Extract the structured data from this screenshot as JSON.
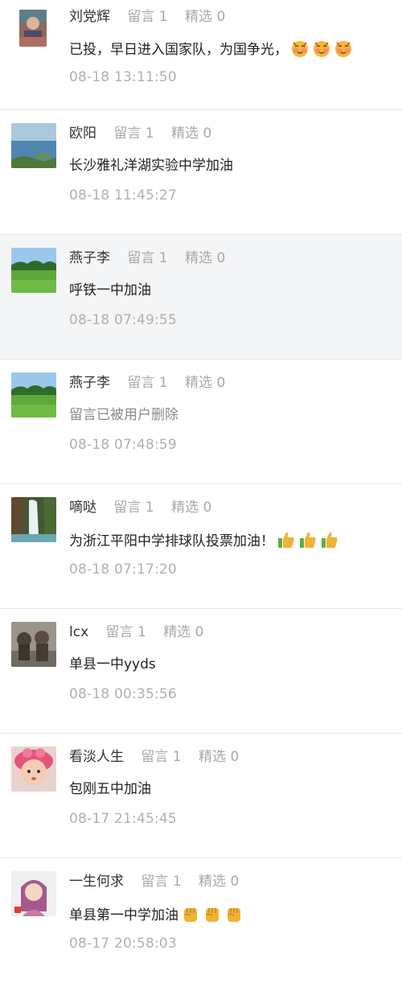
{
  "comments": [
    {
      "name": "刘党辉",
      "replies": "留言 1",
      "featured": "精选 0",
      "text": "已投，早日进入国家队，为国争光，",
      "time": "08-18 13:11:50",
      "emoji": "blush-face-icon",
      "avatar": "portrait-avatar"
    },
    {
      "name": "欧阳",
      "replies": "留言 1",
      "featured": "精选 0",
      "text": "长沙雅礼洋湖实验中学加油",
      "time": "08-18 11:45:27",
      "avatar": "lake-avatar"
    },
    {
      "name": "燕子李",
      "replies": "留言 1",
      "featured": "精选 0",
      "text": "呼铁一中加油",
      "time": "08-18 07:49:55",
      "avatar": "meadow-avatar"
    },
    {
      "name": "燕子李",
      "replies": "留言 1",
      "featured": "精选 0",
      "text": "留言已被用户删除",
      "time": "08-18 07:48:59",
      "avatar": "meadow-avatar"
    },
    {
      "name": "嘀哒",
      "replies": "留言 1",
      "featured": "精选 0",
      "text": "为浙江平阳中学排球队投票加油！",
      "time": "08-18 07:17:20",
      "emoji": "thumbs-up-icon",
      "avatar": "waterfall-avatar"
    },
    {
      "name": "lcx",
      "replies": "留言 1",
      "featured": "精选 0",
      "text": "单县一中yyds",
      "time": "08-18 00:35:56",
      "avatar": "statue-avatar"
    },
    {
      "name": "看淡人生",
      "replies": "留言 1",
      "featured": "精选 0",
      "text": "包刚五中加油",
      "time": "08-17 21:45:45",
      "avatar": "baby-avatar"
    },
    {
      "name": "一生何求",
      "replies": "留言 1",
      "featured": "精选 0",
      "text": "单县第一中学加油",
      "time": "08-17 20:58:03",
      "emoji": "fist-icon",
      "avatar": "woman-avatar"
    }
  ],
  "colors": {
    "name": "#333333",
    "stat": "#a8a8a8",
    "time": "#b0b0b0",
    "highlight_bg": "#f4f5f7",
    "divider": "#e6e6e6"
  }
}
